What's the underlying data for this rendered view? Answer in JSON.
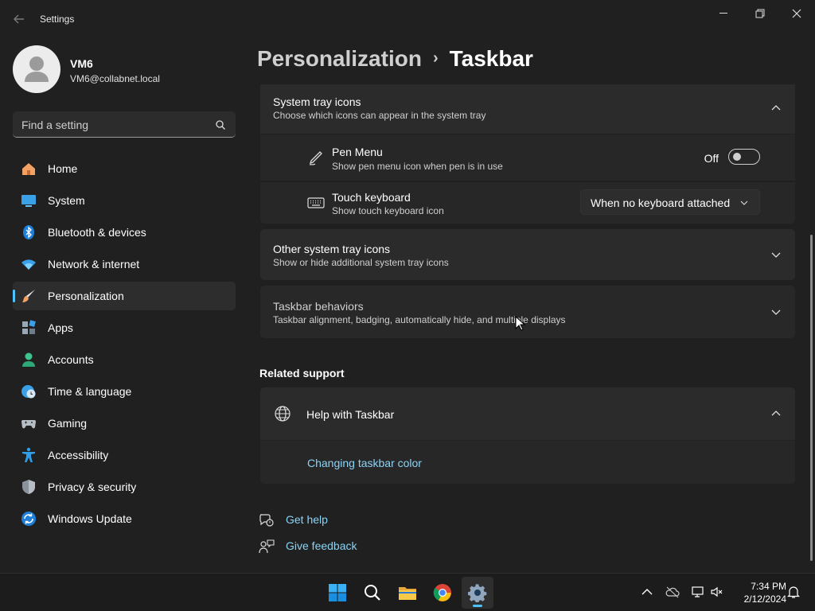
{
  "window": {
    "title": "Settings"
  },
  "user": {
    "name": "VM6",
    "email": "VM6@collabnet.local"
  },
  "search": {
    "placeholder": "Find a setting"
  },
  "nav": [
    {
      "label": "Home",
      "icon": "home-icon"
    },
    {
      "label": "System",
      "icon": "system-icon"
    },
    {
      "label": "Bluetooth & devices",
      "icon": "bluetooth-icon"
    },
    {
      "label": "Network & internet",
      "icon": "wifi-icon"
    },
    {
      "label": "Personalization",
      "icon": "brush-icon",
      "active": true
    },
    {
      "label": "Apps",
      "icon": "apps-icon"
    },
    {
      "label": "Accounts",
      "icon": "accounts-icon"
    },
    {
      "label": "Time & language",
      "icon": "clock-globe-icon"
    },
    {
      "label": "Gaming",
      "icon": "gamepad-icon"
    },
    {
      "label": "Accessibility",
      "icon": "accessibility-icon"
    },
    {
      "label": "Privacy & security",
      "icon": "shield-icon"
    },
    {
      "label": "Windows Update",
      "icon": "update-icon"
    }
  ],
  "breadcrumb": {
    "parent": "Personalization",
    "separator": "›",
    "current": "Taskbar"
  },
  "system_tray": {
    "title": "System tray icons",
    "subtitle": "Choose which icons can appear in the system tray",
    "pen_menu": {
      "title": "Pen Menu",
      "subtitle": "Show pen menu icon when pen is in use",
      "state_label": "Off",
      "on": false
    },
    "touch_keyboard": {
      "title": "Touch keyboard",
      "subtitle": "Show touch keyboard icon",
      "value": "When no keyboard attached"
    }
  },
  "other_tray": {
    "title": "Other system tray icons",
    "subtitle": "Show or hide additional system tray icons"
  },
  "behaviors": {
    "title": "Taskbar behaviors",
    "subtitle": "Taskbar alignment, badging, automatically hide, and multiple displays"
  },
  "related": {
    "title": "Related support",
    "help_title": "Help with Taskbar",
    "link": "Changing taskbar color"
  },
  "footer": {
    "get_help": "Get help",
    "give_feedback": "Give feedback"
  },
  "clock": {
    "time": "7:34 PM",
    "date": "2/12/2024"
  },
  "colors": {
    "accent": "#4cc2ff",
    "link": "#8ad4f7",
    "background": "#202020",
    "card": "#2b2b2b"
  }
}
